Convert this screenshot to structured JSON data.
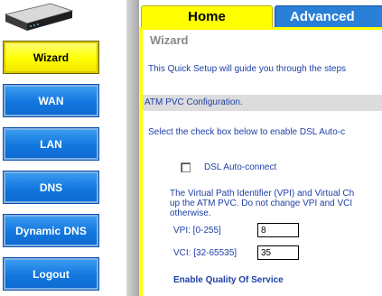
{
  "sidebar": {
    "items": [
      {
        "label": "Wizard",
        "active": true
      },
      {
        "label": "WAN",
        "active": false
      },
      {
        "label": "LAN",
        "active": false
      },
      {
        "label": "DNS",
        "active": false
      },
      {
        "label": "Dynamic DNS",
        "active": false
      },
      {
        "label": "Logout",
        "active": false
      }
    ]
  },
  "tabs": {
    "home": "Home",
    "advanced": "Advanced"
  },
  "main": {
    "title": "Wizard",
    "intro": "This Quick Setup will guide you through the steps",
    "section_header": "ATM PVC Configuration.",
    "instruction": "Select the check box below to enable DSL Auto-c",
    "dsl_autoconnect_label": "DSL Auto-connect",
    "vpi_desc_line1": "The Virtual Path Identifier (VPI) and Virtual Ch",
    "vpi_desc_line2": "up the ATM PVC. Do not change VPI and VCI",
    "vpi_desc_line3": "otherwise.",
    "vpi_label": "VPI: [0-255]",
    "vpi_value": "8",
    "vci_label": "VCI: [32-65535]",
    "vci_value": "35",
    "qos_label": "Enable Quality Of Service"
  },
  "colors": {
    "active_nav": "#ffff00",
    "nav_blue": "#1277df",
    "text_blue": "#1e3fa8"
  }
}
